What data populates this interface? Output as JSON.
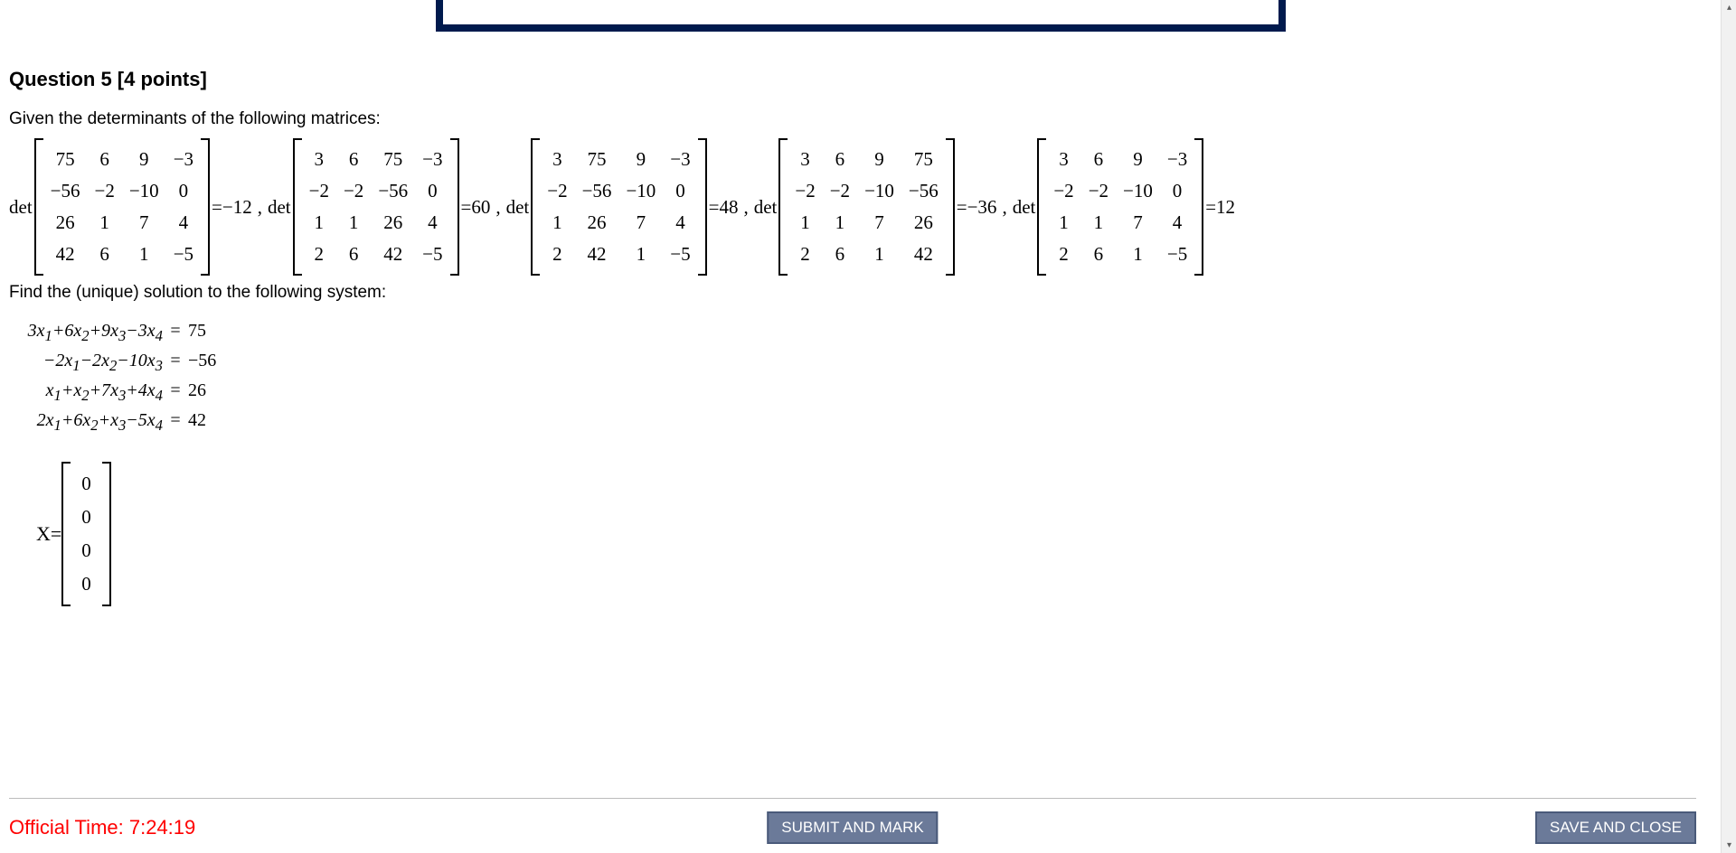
{
  "question": {
    "title": "Question 5 [4 points]",
    "given_text": "Given the determinants of the following matrices:",
    "find_text": "Find the (unique) solution to the following system:"
  },
  "det_label": "det",
  "matrices": [
    {
      "rows": [
        [
          "75",
          "6",
          "9",
          "−3"
        ],
        [
          "−56",
          "−2",
          "−10",
          "0"
        ],
        [
          "26",
          "1",
          "7",
          "4"
        ],
        [
          "42",
          "6",
          "1",
          "−5"
        ]
      ],
      "value": "−12"
    },
    {
      "rows": [
        [
          "3",
          "6",
          "75",
          "−3"
        ],
        [
          "−2",
          "−2",
          "−56",
          "0"
        ],
        [
          "1",
          "1",
          "26",
          "4"
        ],
        [
          "2",
          "6",
          "42",
          "−5"
        ]
      ],
      "value": "60"
    },
    {
      "rows": [
        [
          "3",
          "75",
          "9",
          "−3"
        ],
        [
          "−2",
          "−56",
          "−10",
          "0"
        ],
        [
          "1",
          "26",
          "7",
          "4"
        ],
        [
          "2",
          "42",
          "1",
          "−5"
        ]
      ],
      "value": "48"
    },
    {
      "rows": [
        [
          "3",
          "6",
          "9",
          "75"
        ],
        [
          "−2",
          "−2",
          "−10",
          "−56"
        ],
        [
          "1",
          "1",
          "7",
          "26"
        ],
        [
          "2",
          "6",
          "1",
          "42"
        ]
      ],
      "value": "−36"
    },
    {
      "rows": [
        [
          "3",
          "6",
          "9",
          "−3"
        ],
        [
          "−2",
          "−2",
          "−10",
          "0"
        ],
        [
          "1",
          "1",
          "7",
          "4"
        ],
        [
          "2",
          "6",
          "1",
          "−5"
        ]
      ],
      "value": "12"
    }
  ],
  "equations": [
    {
      "lhs_html": "3<i>x</i><sub>1</sub>+6<i>x</i><sub>2</sub>+9<i>x</i><sub>3</sub>−3<i>x</i><sub>4</sub>",
      "rhs": "75"
    },
    {
      "lhs_html": "−2<i>x</i><sub>1</sub>−2<i>x</i><sub>2</sub>−10<i>x</i><sub>3</sub>",
      "rhs": "−56"
    },
    {
      "lhs_html": "<i>x</i><sub>1</sub>+<i>x</i><sub>2</sub>+7<i>x</i><sub>3</sub>+4<i>x</i><sub>4</sub>",
      "rhs": "26"
    },
    {
      "lhs_html": "2<i>x</i><sub>1</sub>+6<i>x</i><sub>2</sub>+<i>x</i><sub>3</sub>−5<i>x</i><sub>4</sub>",
      "rhs": "42"
    }
  ],
  "solution": {
    "label": "X=",
    "values": [
      "0",
      "0",
      "0",
      "0"
    ]
  },
  "footer": {
    "official_time_label": "Official Time: ",
    "official_time_value": "7:24:19",
    "submit_label": "SUBMIT AND MARK",
    "save_label": "SAVE AND CLOSE"
  }
}
